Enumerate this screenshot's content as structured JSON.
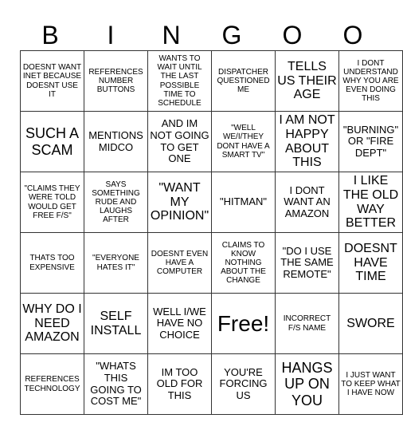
{
  "header": [
    "B",
    "I",
    "N",
    "G",
    "O",
    "O"
  ],
  "rows": [
    [
      {
        "t": "DOESNT WANT INET BECAUSE DOESNT USE IT",
        "s": "s"
      },
      {
        "t": "REFERENCES NUMBER BUTTONS",
        "s": "s"
      },
      {
        "t": "WANTS TO WAIT UNTIL THE LAST POSSIBLE TIME TO SCHEDULE",
        "s": "s"
      },
      {
        "t": "DISPATCHER QUESTIONED ME",
        "s": "s"
      },
      {
        "t": "TELLS US THEIR AGE",
        "s": "l"
      },
      {
        "t": "I DONT UNDERSTAND WHY YOU ARE EVEN DOING THIS",
        "s": "s"
      }
    ],
    [
      {
        "t": "SUCH A SCAM",
        "s": "xl"
      },
      {
        "t": "MENTIONS MIDCO",
        "s": "m"
      },
      {
        "t": "AND IM NOT GOING TO GET ONE",
        "s": "m"
      },
      {
        "t": "\"WELL WE/I/THEY DONT HAVE A SMART TV\"",
        "s": "s"
      },
      {
        "t": "I AM NOT HAPPY ABOUT THIS",
        "s": "l"
      },
      {
        "t": "\"BURNING\" OR \"FIRE DEPT\"",
        "s": "m"
      }
    ],
    [
      {
        "t": "\"CLAIMS THEY WERE TOLD WOULD GET FREE F/S\"",
        "s": "s"
      },
      {
        "t": "SAYS SOMETHING RUDE AND LAUGHS AFTER",
        "s": "s"
      },
      {
        "t": "\"WANT MY OPINION\"",
        "s": "l"
      },
      {
        "t": "\"HITMAN\"",
        "s": "m"
      },
      {
        "t": "I DONT WANT AN AMAZON",
        "s": "m"
      },
      {
        "t": "I LIKE THE OLD WAY BETTER",
        "s": "l"
      }
    ],
    [
      {
        "t": "THATS TOO EXPENSIVE",
        "s": "s"
      },
      {
        "t": "\"EVERYONE HATES IT\"",
        "s": "s"
      },
      {
        "t": "DOESNT EVEN HAVE A COMPUTER",
        "s": "s"
      },
      {
        "t": "CLAIMS TO KNOW NOTHING ABOUT THE CHANGE",
        "s": "s"
      },
      {
        "t": "\"DO I USE THE SAME REMOTE\"",
        "s": "m"
      },
      {
        "t": "DOESNT HAVE TIME",
        "s": "l"
      }
    ],
    [
      {
        "t": "WHY DO I NEED AMAZON",
        "s": "l"
      },
      {
        "t": "SELF INSTALL",
        "s": "l"
      },
      {
        "t": "WELL I/WE HAVE NO CHOICE",
        "s": "m"
      },
      {
        "t": "Free!",
        "s": "free"
      },
      {
        "t": "INCORRECT F/S NAME",
        "s": "s"
      },
      {
        "t": "SWORE",
        "s": "l"
      }
    ],
    [
      {
        "t": "REFERENCES TECHNOLOGY",
        "s": "s"
      },
      {
        "t": "\"WHATS THIS GOING TO COST ME\"",
        "s": "m"
      },
      {
        "t": "IM TOO OLD FOR THIS",
        "s": "m"
      },
      {
        "t": "YOU'RE FORCING US",
        "s": "m"
      },
      {
        "t": "HANGS UP ON YOU",
        "s": "xl"
      },
      {
        "t": "I JUST WANT TO KEEP WHAT I HAVE NOW",
        "s": "s"
      }
    ]
  ]
}
